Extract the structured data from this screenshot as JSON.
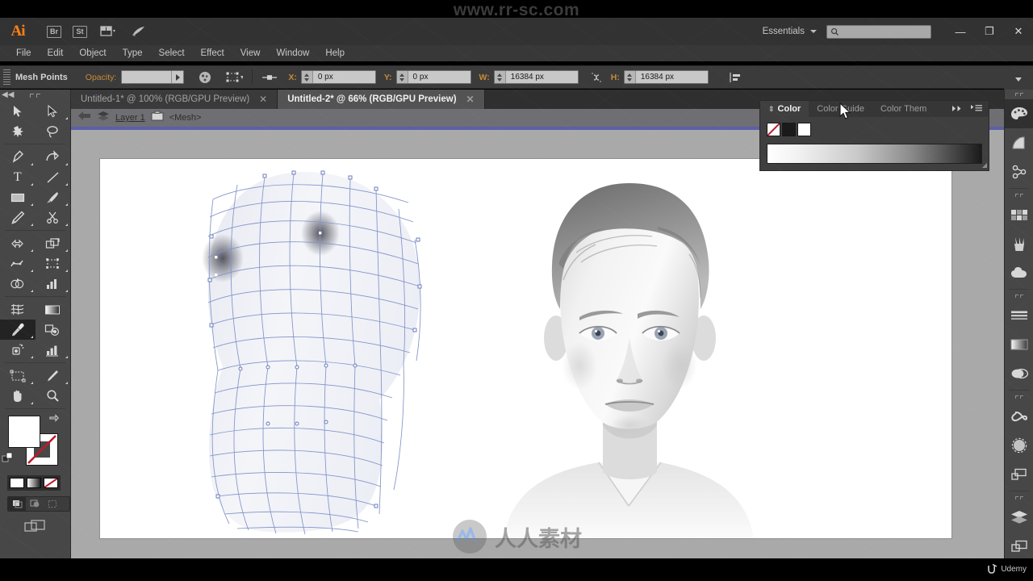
{
  "watermark": {
    "top_url": "www.rr-sc.com",
    "center_logo_text": "人人素材",
    "brand_bottom_right": "Udemy"
  },
  "appbar": {
    "logo": "Ai",
    "icons": [
      "bridge-icon",
      "stock-icon",
      "arrange-documents-icon",
      "rocket-icon"
    ],
    "bridge_label": "Br",
    "stock_label": "St",
    "workspace": "Essentials",
    "search_placeholder": "",
    "search_value": "",
    "window_buttons": {
      "minimize": "—",
      "restore": "❐",
      "close": "✕"
    }
  },
  "menubar": {
    "items": [
      "File",
      "Edit",
      "Object",
      "Type",
      "Select",
      "Effect",
      "View",
      "Window",
      "Help"
    ]
  },
  "controlbar": {
    "selection_label": "Mesh Points",
    "opacity_label": "Opacity:",
    "opacity_value": "",
    "x_label": "X:",
    "x_value": "0 px",
    "y_label": "Y:",
    "y_value": "0 px",
    "w_label": "W:",
    "w_value": "16384 px",
    "h_label": "H:",
    "h_value": "16384 px",
    "lock_ratio_icon": "link-broken-icon",
    "recolor_icon": "recolor-artwork-icon",
    "transform_icon": "transform-icon",
    "align_icon": "align-icon",
    "menu_icon": "panel-menu-icon"
  },
  "tabs": [
    {
      "title": "Untitled-1* @ 100% (RGB/GPU Preview)",
      "active": false,
      "close": "✕"
    },
    {
      "title": "Untitled-2* @ 66% (RGB/GPU Preview)",
      "active": true,
      "close": "✕"
    }
  ],
  "breadcrumb": {
    "back_icon": "back-arrow-icon",
    "layers_icon": "layers-icon",
    "layer_name": "Layer 1",
    "group_icon": "group-icon",
    "object_name": "<Mesh>"
  },
  "toolbar": {
    "tools": [
      {
        "name": "selection-tool",
        "glyph": "selection",
        "has_flyout": false,
        "selected": false
      },
      {
        "name": "direct-selection-tool",
        "glyph": "direct-selection",
        "has_flyout": true,
        "selected": false
      },
      {
        "name": "magic-wand-tool",
        "glyph": "magic-wand",
        "has_flyout": false,
        "selected": false
      },
      {
        "name": "lasso-tool",
        "glyph": "lasso",
        "has_flyout": false,
        "selected": false
      },
      {
        "name": "pen-tool",
        "glyph": "pen",
        "has_flyout": true,
        "selected": false
      },
      {
        "name": "curvature-tool",
        "glyph": "curvature",
        "has_flyout": false,
        "selected": false
      },
      {
        "name": "type-tool",
        "glyph": "type",
        "has_flyout": true,
        "selected": false
      },
      {
        "name": "line-segment-tool",
        "glyph": "line",
        "has_flyout": true,
        "selected": false
      },
      {
        "name": "rectangle-tool",
        "glyph": "rectangle",
        "has_flyout": true,
        "selected": false
      },
      {
        "name": "paintbrush-tool",
        "glyph": "paintbrush",
        "has_flyout": true,
        "selected": false
      },
      {
        "name": "shaper-pencil-tool",
        "glyph": "pencil",
        "has_flyout": true,
        "selected": false
      },
      {
        "name": "scissors-tool",
        "glyph": "scissors",
        "has_flyout": true,
        "selected": false
      },
      {
        "name": "rotate-tool",
        "glyph": "rotate",
        "has_flyout": true,
        "selected": false
      },
      {
        "name": "scale-reflect-tool",
        "glyph": "scale",
        "has_flyout": true,
        "selected": false
      },
      {
        "name": "width-warp-tool",
        "glyph": "warp",
        "has_flyout": true,
        "selected": false
      },
      {
        "name": "free-transform-tool",
        "glyph": "free-transform",
        "has_flyout": true,
        "selected": false
      },
      {
        "name": "shape-builder-tool",
        "glyph": "shape-builder",
        "has_flyout": true,
        "selected": false
      },
      {
        "name": "perspective-grid-tool",
        "glyph": "graph",
        "has_flyout": true,
        "selected": false
      },
      {
        "name": "mesh-tool",
        "glyph": "mesh",
        "has_flyout": false,
        "selected": false
      },
      {
        "name": "gradient-tool",
        "glyph": "gradient",
        "has_flyout": false,
        "selected": false
      },
      {
        "name": "eyedropper-tool",
        "glyph": "eyedropper",
        "has_flyout": true,
        "selected": true
      },
      {
        "name": "blend-tool",
        "glyph": "blend",
        "has_flyout": false,
        "selected": false
      },
      {
        "name": "symbol-sprayer-tool",
        "glyph": "symbol-sprayer",
        "has_flyout": true,
        "selected": false
      },
      {
        "name": "column-graph-tool",
        "glyph": "column-graph",
        "has_flyout": true,
        "selected": false
      },
      {
        "name": "artboard-tool",
        "glyph": "artboard",
        "has_flyout": false,
        "selected": false
      },
      {
        "name": "slice-tool",
        "glyph": "slice",
        "has_flyout": true,
        "selected": false
      },
      {
        "name": "hand-tool",
        "glyph": "hand",
        "has_flyout": true,
        "selected": false
      },
      {
        "name": "zoom-tool",
        "glyph": "zoom",
        "has_flyout": false,
        "selected": false
      }
    ],
    "fill_color": "#ffffff",
    "stroke_color": "none",
    "swap_icon": "swap-fill-stroke-icon",
    "default_icon": "default-fill-stroke-icon",
    "paint_modes": [
      "color-swatch",
      "gradient-swatch",
      "none-swatch"
    ],
    "draw_modes": [
      "draw-normal",
      "draw-behind",
      "draw-inside"
    ],
    "screen_mode_icon": "change-screen-mode-icon"
  },
  "color_panel": {
    "tabs": [
      {
        "label": "Color",
        "active": true
      },
      {
        "label": "Color Guide",
        "active": false
      },
      {
        "label": "Color Them",
        "active": false
      }
    ],
    "expand_icon": "double-arrow-icon",
    "menu_icon": "panel-menu-icon",
    "swatches": [
      {
        "name": "none-swatch",
        "color": "none"
      },
      {
        "name": "black-swatch",
        "color": "#1a1a1a"
      },
      {
        "name": "white-swatch",
        "color": "#ffffff"
      }
    ],
    "ramp_name": "grayscale-spectrum-ramp"
  },
  "dock": {
    "groups": [
      [
        {
          "name": "color-panel-icon",
          "glyph": "palette",
          "selected": true
        },
        {
          "name": "color-guide-panel-icon",
          "glyph": "color-guide",
          "selected": false
        },
        {
          "name": "color-themes-panel-icon",
          "glyph": "color-themes",
          "selected": false
        }
      ],
      [
        {
          "name": "swatches-panel-icon",
          "glyph": "swatches",
          "selected": false
        },
        {
          "name": "brushes-panel-icon",
          "glyph": "brushes",
          "selected": false
        },
        {
          "name": "symbols-panel-icon",
          "glyph": "symbols",
          "selected": false
        }
      ],
      [
        {
          "name": "stroke-panel-icon",
          "glyph": "stroke",
          "selected": false
        },
        {
          "name": "gradient-panel-icon",
          "glyph": "gradient",
          "selected": false
        },
        {
          "name": "transparency-panel-icon",
          "glyph": "transparency",
          "selected": false
        }
      ],
      [
        {
          "name": "libraries-panel-icon",
          "glyph": "cc-libraries",
          "selected": false
        },
        {
          "name": "appearance-panel-icon",
          "glyph": "appearance",
          "selected": false
        },
        {
          "name": "align-panel-icon",
          "glyph": "align",
          "selected": false
        }
      ],
      [
        {
          "name": "layers-panel-icon",
          "glyph": "layers",
          "selected": false
        },
        {
          "name": "artboards-panel-icon",
          "glyph": "artboards",
          "selected": false
        }
      ]
    ]
  },
  "canvas": {
    "mesh_object_name": "gradient-mesh-head",
    "reference_photo_name": "portrait-reference-photo",
    "mesh_line_color": "#8193c9",
    "anchor_color": "#6e80bb"
  },
  "scrollbar": {
    "name": "vertical-scrollbar"
  }
}
